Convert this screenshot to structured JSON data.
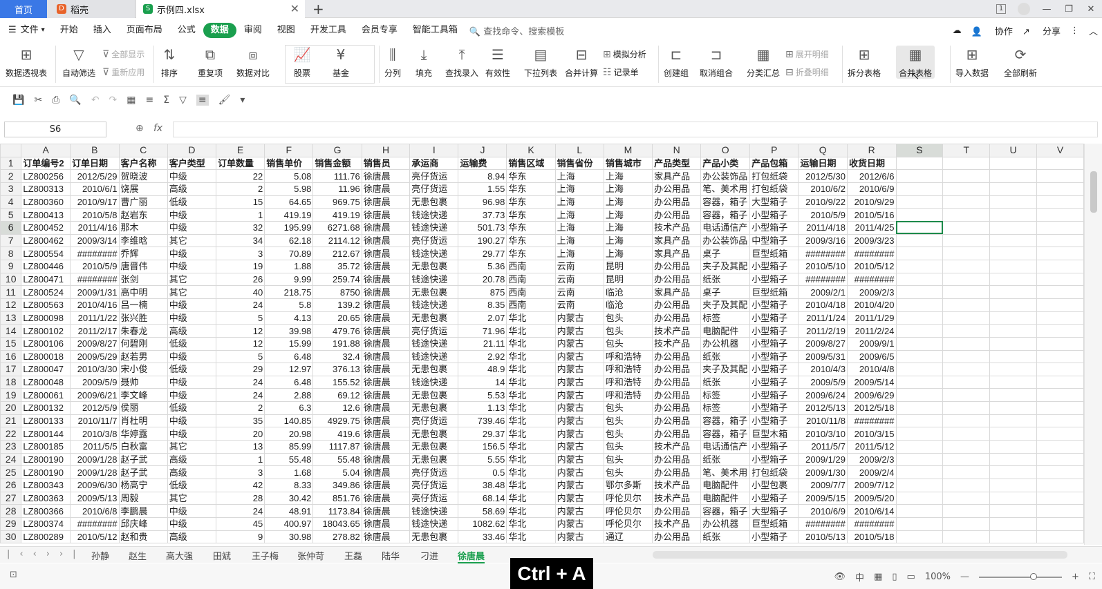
{
  "titlebar": {
    "tab_home": "首页",
    "tab_daoke": "稻壳",
    "tab_file": "示例四.xlsx",
    "tab_add": "+",
    "win_badge": "1"
  },
  "menubar": {
    "file": "文件",
    "items": [
      "开始",
      "插入",
      "页面布局",
      "公式",
      "数据",
      "审阅",
      "视图",
      "开发工具",
      "会员专享",
      "智能工具箱"
    ],
    "active": "数据",
    "search_placeholder": "查找命令、搜索模板",
    "collab": "协作",
    "share": "分享"
  },
  "ribbon": {
    "pivot": "数据透视表",
    "autofilter": "自动筛选",
    "show_all": "全部显示",
    "reapply": "重新应用",
    "sort": "排序",
    "duplicates": "重复项",
    "compare": "数据对比",
    "stocks": "股票",
    "funds": "基金",
    "split": "分列",
    "fill": "填充",
    "lookup": "查找录入",
    "validity": "有效性",
    "dropdown": "下拉列表",
    "consolidate": "合并计算",
    "whatif": "模拟分析",
    "recordform": "记录单",
    "group": "创建组",
    "ungroup": "取消组合",
    "subtotal": "分类汇总",
    "expand": "展开明细",
    "collapse": "折叠明细",
    "split_table": "拆分表格",
    "merge_table": "合并表格",
    "import": "导入数据",
    "refresh_all": "全部刷新"
  },
  "formula": {
    "namebox": "S6",
    "fx": "fx",
    "value": ""
  },
  "grid": {
    "columns": [
      "A",
      "B",
      "C",
      "D",
      "E",
      "F",
      "G",
      "H",
      "I",
      "J",
      "K",
      "L",
      "M",
      "N",
      "O",
      "P",
      "Q",
      "R",
      "S",
      "T",
      "U",
      "V"
    ],
    "selected_column": "S",
    "selected_row": "6",
    "rows": [
      {
        "n": "1",
        "c": [
          "订单编号2",
          "订单日期",
          "客户名称",
          "客户类型",
          "订单数量",
          "销售单价",
          "销售金额",
          "销售员",
          "承运商",
          "运输费",
          "销售区域",
          "销售省份",
          "销售城市",
          "产品类型",
          "产品小类",
          "产品包箱",
          "运输日期",
          "收货日期"
        ]
      },
      {
        "n": "2",
        "c": [
          "LZ800256",
          "2012/5/29",
          "贺晓波",
          "中级",
          "22",
          "5.08",
          "111.76",
          "徐唐晨",
          "亮仔货运",
          "8.94",
          "华东",
          "上海",
          "上海",
          "家具产品",
          "办公装饰品",
          "打包纸袋",
          "2012/5/30",
          "2012/6/6"
        ]
      },
      {
        "n": "3",
        "c": [
          "LZ800313",
          "2010/6/1",
          "饶展",
          "高级",
          "2",
          "5.98",
          "11.96",
          "徐唐晨",
          "亮仔货运",
          "1.55",
          "华东",
          "上海",
          "上海",
          "办公用品",
          "笔、美术用",
          "打包纸袋",
          "2010/6/2",
          "2010/6/9"
        ]
      },
      {
        "n": "4",
        "c": [
          "LZ800360",
          "2010/9/17",
          "曹广丽",
          "低级",
          "15",
          "64.65",
          "969.75",
          "徐唐晨",
          "无患包裹",
          "96.98",
          "华东",
          "上海",
          "上海",
          "办公用品",
          "容器，箱子",
          "大型箱子",
          "2010/9/22",
          "2010/9/29"
        ]
      },
      {
        "n": "5",
        "c": [
          "LZ800413",
          "2010/5/8",
          "赵岩东",
          "中级",
          "1",
          "419.19",
          "419.19",
          "徐唐晨",
          "钱途快递",
          "37.73",
          "华东",
          "上海",
          "上海",
          "办公用品",
          "容器，箱子",
          "小型箱子",
          "2010/5/9",
          "2010/5/16"
        ]
      },
      {
        "n": "6",
        "c": [
          "LZ800452",
          "2011/4/16",
          "那木",
          "中级",
          "32",
          "195.99",
          "6271.68",
          "徐唐晨",
          "钱途快递",
          "501.73",
          "华东",
          "上海",
          "上海",
          "技术产品",
          "电话通信产",
          "小型箱子",
          "2011/4/18",
          "2011/4/25"
        ]
      },
      {
        "n": "7",
        "c": [
          "LZ800462",
          "2009/3/14",
          "李维晗",
          "其它",
          "34",
          "62.18",
          "2114.12",
          "徐唐晨",
          "亮仔货运",
          "190.27",
          "华东",
          "上海",
          "上海",
          "家具产品",
          "办公装饰品",
          "中型箱子",
          "2009/3/16",
          "2009/3/23"
        ]
      },
      {
        "n": "8",
        "c": [
          "LZ800554",
          "########",
          "乔辉",
          "中级",
          "3",
          "70.89",
          "212.67",
          "徐唐晨",
          "钱途快递",
          "29.77",
          "华东",
          "上海",
          "上海",
          "家具产品",
          "桌子",
          "巨型纸箱",
          "########",
          "########"
        ]
      },
      {
        "n": "9",
        "c": [
          "LZ800446",
          "2010/5/9",
          "唐晋伟",
          "中级",
          "19",
          "1.88",
          "35.72",
          "徐唐晨",
          "无患包裹",
          "5.36",
          "西南",
          "云南",
          "昆明",
          "办公用品",
          "夹子及其配",
          "小型箱子",
          "2010/5/10",
          "2010/5/12"
        ]
      },
      {
        "n": "10",
        "c": [
          "LZ800471",
          "########",
          "张剑",
          "其它",
          "26",
          "9.99",
          "259.74",
          "徐唐晨",
          "钱途快递",
          "20.78",
          "西南",
          "云南",
          "昆明",
          "办公用品",
          "纸张",
          "小型箱子",
          "########",
          "########"
        ]
      },
      {
        "n": "11",
        "c": [
          "LZ800524",
          "2009/1/31",
          "高中明",
          "其它",
          "40",
          "218.75",
          "8750",
          "徐唐晨",
          "无患包裹",
          "875",
          "西南",
          "云南",
          "临沧",
          "家具产品",
          "桌子",
          "巨型纸箱",
          "2009/2/1",
          "2009/2/3"
        ]
      },
      {
        "n": "12",
        "c": [
          "LZ800563",
          "2010/4/16",
          "吕一楠",
          "中级",
          "24",
          "5.8",
          "139.2",
          "徐唐晨",
          "钱途快递",
          "8.35",
          "西南",
          "云南",
          "临沧",
          "办公用品",
          "夹子及其配",
          "小型箱子",
          "2010/4/18",
          "2010/4/20"
        ]
      },
      {
        "n": "13",
        "c": [
          "LZ800098",
          "2011/1/22",
          "张兴胜",
          "中级",
          "5",
          "4.13",
          "20.65",
          "徐唐晨",
          "无患包裹",
          "2.07",
          "华北",
          "内蒙古",
          "包头",
          "办公用品",
          "标签",
          "小型箱子",
          "2011/1/24",
          "2011/1/29"
        ]
      },
      {
        "n": "14",
        "c": [
          "LZ800102",
          "2011/2/17",
          "朱春龙",
          "高级",
          "12",
          "39.98",
          "479.76",
          "徐唐晨",
          "亮仔货运",
          "71.96",
          "华北",
          "内蒙古",
          "包头",
          "技术产品",
          "电脑配件",
          "小型箱子",
          "2011/2/19",
          "2011/2/24"
        ]
      },
      {
        "n": "15",
        "c": [
          "LZ800106",
          "2009/8/27",
          "何碧刚",
          "低级",
          "12",
          "15.99",
          "191.88",
          "徐唐晨",
          "钱途快递",
          "21.11",
          "华北",
          "内蒙古",
          "包头",
          "技术产品",
          "办公机器",
          "小型箱子",
          "2009/8/27",
          "2009/9/1"
        ]
      },
      {
        "n": "16",
        "c": [
          "LZ800018",
          "2009/5/29",
          "赵若男",
          "中级",
          "5",
          "6.48",
          "32.4",
          "徐唐晨",
          "钱途快递",
          "2.92",
          "华北",
          "内蒙古",
          "呼和浩特",
          "办公用品",
          "纸张",
          "小型箱子",
          "2009/5/31",
          "2009/6/5"
        ]
      },
      {
        "n": "17",
        "c": [
          "LZ800047",
          "2010/3/30",
          "宋小俊",
          "低级",
          "29",
          "12.97",
          "376.13",
          "徐唐晨",
          "无患包裹",
          "48.9",
          "华北",
          "内蒙古",
          "呼和浩特",
          "办公用品",
          "夹子及其配",
          "小型箱子",
          "2010/4/3",
          "2010/4/8"
        ]
      },
      {
        "n": "18",
        "c": [
          "LZ800048",
          "2009/5/9",
          "聂帅",
          "中级",
          "24",
          "6.48",
          "155.52",
          "徐唐晨",
          "钱途快递",
          "14",
          "华北",
          "内蒙古",
          "呼和浩特",
          "办公用品",
          "纸张",
          "小型箱子",
          "2009/5/9",
          "2009/5/14"
        ]
      },
      {
        "n": "19",
        "c": [
          "LZ800061",
          "2009/6/21",
          "李文峰",
          "中级",
          "24",
          "2.88",
          "69.12",
          "徐唐晨",
          "无患包裹",
          "5.53",
          "华北",
          "内蒙古",
          "呼和浩特",
          "办公用品",
          "标签",
          "小型箱子",
          "2009/6/24",
          "2009/6/29"
        ]
      },
      {
        "n": "20",
        "c": [
          "LZ800132",
          "2012/5/9",
          "侯丽",
          "低级",
          "2",
          "6.3",
          "12.6",
          "徐唐晨",
          "无患包裹",
          "1.13",
          "华北",
          "内蒙古",
          "包头",
          "办公用品",
          "标签",
          "小型箱子",
          "2012/5/13",
          "2012/5/18"
        ]
      },
      {
        "n": "21",
        "c": [
          "LZ800133",
          "2010/11/7",
          "肖杜明",
          "中级",
          "35",
          "140.85",
          "4929.75",
          "徐唐晨",
          "亮仔货运",
          "739.46",
          "华北",
          "内蒙古",
          "包头",
          "办公用品",
          "容器，箱子",
          "小型箱子",
          "2010/11/8",
          "########"
        ]
      },
      {
        "n": "22",
        "c": [
          "LZ800144",
          "2010/3/8",
          "华婷露",
          "中级",
          "20",
          "20.98",
          "419.6",
          "徐唐晨",
          "无患包裹",
          "29.37",
          "华北",
          "内蒙古",
          "包头",
          "办公用品",
          "容器，箱子",
          "巨型木箱",
          "2010/3/10",
          "2010/3/15"
        ]
      },
      {
        "n": "23",
        "c": [
          "LZ800185",
          "2011/5/5",
          "白秋富",
          "其它",
          "13",
          "85.99",
          "1117.87",
          "徐唐晨",
          "无患包裹",
          "156.5",
          "华北",
          "内蒙古",
          "包头",
          "技术产品",
          "电话通信产",
          "小型箱子",
          "2011/5/7",
          "2011/5/12"
        ]
      },
      {
        "n": "24",
        "c": [
          "LZ800190",
          "2009/1/28",
          "赵子武",
          "高级",
          "1",
          "55.48",
          "55.48",
          "徐唐晨",
          "无患包裹",
          "5.55",
          "华北",
          "内蒙古",
          "包头",
          "办公用品",
          "纸张",
          "小型箱子",
          "2009/1/29",
          "2009/2/3"
        ]
      },
      {
        "n": "25",
        "c": [
          "LZ800190",
          "2009/1/28",
          "赵子武",
          "高级",
          "3",
          "1.68",
          "5.04",
          "徐唐晨",
          "亮仔货运",
          "0.5",
          "华北",
          "内蒙古",
          "包头",
          "办公用品",
          "笔、美术用",
          "打包纸袋",
          "2009/1/30",
          "2009/2/4"
        ]
      },
      {
        "n": "26",
        "c": [
          "LZ800343",
          "2009/6/30",
          "杨高宁",
          "低级",
          "42",
          "8.33",
          "349.86",
          "徐唐晨",
          "亮仔货运",
          "38.48",
          "华北",
          "内蒙古",
          "鄂尔多斯",
          "技术产品",
          "电脑配件",
          "小型包裹",
          "2009/7/7",
          "2009/7/12"
        ]
      },
      {
        "n": "27",
        "c": [
          "LZ800363",
          "2009/5/13",
          "周毅",
          "其它",
          "28",
          "30.42",
          "851.76",
          "徐唐晨",
          "亮仔货运",
          "68.14",
          "华北",
          "内蒙古",
          "呼伦贝尔",
          "技术产品",
          "电脑配件",
          "小型箱子",
          "2009/5/15",
          "2009/5/20"
        ]
      },
      {
        "n": "28",
        "c": [
          "LZ800366",
          "2010/6/8",
          "李鹏晨",
          "中级",
          "24",
          "48.91",
          "1173.84",
          "徐唐晨",
          "钱途快递",
          "58.69",
          "华北",
          "内蒙古",
          "呼伦贝尔",
          "办公用品",
          "容器，箱子",
          "大型箱子",
          "2010/6/9",
          "2010/6/14"
        ]
      },
      {
        "n": "29",
        "c": [
          "LZ800374",
          "########",
          "邱庆峰",
          "中级",
          "45",
          "400.97",
          "18043.65",
          "徐唐晨",
          "钱途快递",
          "1082.62",
          "华北",
          "内蒙古",
          "呼伦贝尔",
          "技术产品",
          "办公机器",
          "巨型纸箱",
          "########",
          "########"
        ]
      },
      {
        "n": "30",
        "c": [
          "LZ800289",
          "2010/5/12",
          "赵和贵",
          "高级",
          "9",
          "30.98",
          "278.82",
          "徐唐晨",
          "无患包裹",
          "33.46",
          "华北",
          "内蒙古",
          "通辽",
          "办公用品",
          "纸张",
          "小型箱子",
          "2010/5/13",
          "2010/5/18"
        ]
      }
    ]
  },
  "sheets": {
    "tabs": [
      "孙静",
      "赵生",
      "高大强",
      "田斌",
      "王子梅",
      "张仲苛",
      "王磊",
      "陆华",
      "刁进",
      "徐唐晨"
    ],
    "active": "徐唐晨"
  },
  "status": {
    "zoom": "100%",
    "zoom_minus": "—",
    "zoom_plus": "+"
  },
  "key_hint": "Ctrl + A"
}
